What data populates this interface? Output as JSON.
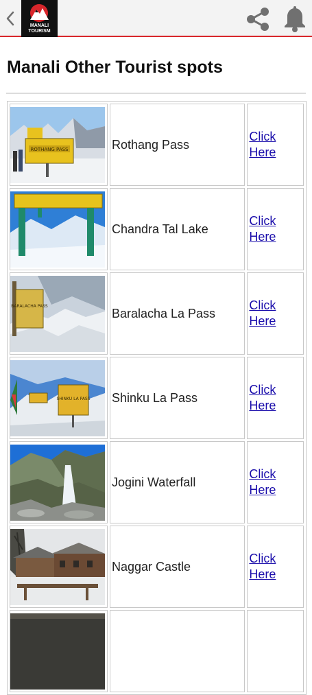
{
  "header": {
    "logo_line1": "MANALI",
    "logo_line2": "TOURISM",
    "colors": {
      "accent": "#d8262b",
      "bar": "#f3f3f3",
      "icon": "#707070"
    }
  },
  "page": {
    "title": "Manali Other Tourist spots"
  },
  "spots": [
    {
      "name": "Rothang Pass",
      "link": "Click Here",
      "sign": "ROTHANG PASS"
    },
    {
      "name": "Chandra Tal Lake",
      "link": "Click Here"
    },
    {
      "name": "Baralacha La Pass",
      "link": "Click Here",
      "sign": "BARALACHA PASS"
    },
    {
      "name": "Shinku La Pass",
      "link": "Click Here",
      "sign": "SHINKU LA PASS"
    },
    {
      "name": "Jogini Waterfall",
      "link": "Click Here"
    },
    {
      "name": "Naggar Castle",
      "link": "Click Here"
    }
  ]
}
